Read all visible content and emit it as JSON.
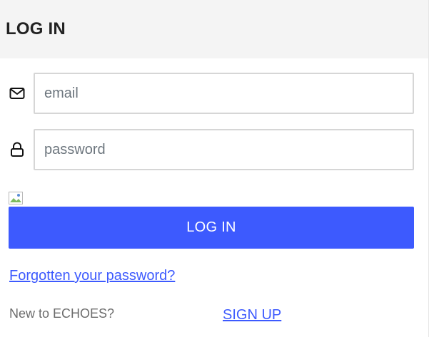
{
  "header": {
    "title": "LOG IN"
  },
  "form": {
    "email": {
      "icon": "mail-icon",
      "value": "",
      "placeholder": "email"
    },
    "password": {
      "icon": "lock-icon",
      "value": "",
      "placeholder": "password"
    },
    "image_icon": "broken-image-icon",
    "submit_label": "LOG IN"
  },
  "links": {
    "forgot_password": "Forgotten your password?",
    "new_to_text": "New to ECHOES?",
    "sign_up": "SIGN UP"
  },
  "colors": {
    "accent": "#3d5afe",
    "header_bg": "#f4f4f4",
    "input_border": "#d6d6d6"
  }
}
